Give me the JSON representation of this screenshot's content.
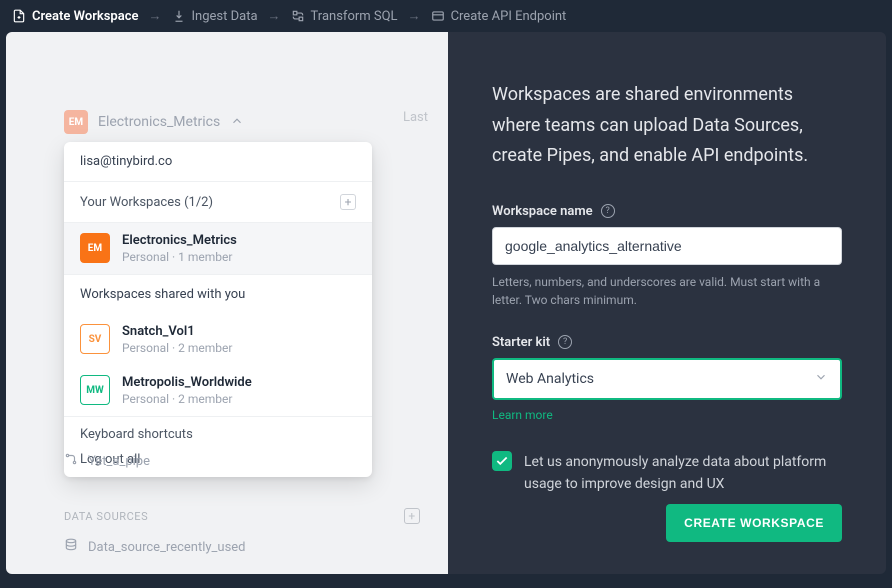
{
  "breadcrumbs": {
    "create_workspace": "Create Workspace",
    "ingest_data": "Ingest Data",
    "transform_sql": "Transform SQL",
    "create_api": "Create API Endpoint"
  },
  "workspace_switcher": {
    "badge": "EM",
    "current_name": "Electronics_Metrics",
    "last_label": "Last"
  },
  "dropdown": {
    "email": "lisa@tinybird.co",
    "your_ws_header": "Your Workspaces (1/2)",
    "own": {
      "badge": "EM",
      "name": "Electronics_Metrics",
      "meta": "Personal · 1 member"
    },
    "shared_header": "Workspaces shared with you",
    "shared": [
      {
        "badge": "SV",
        "name": "Snatch_Vol1",
        "meta": "Personal · 2 member"
      },
      {
        "badge": "MW",
        "name": "Metropolis_Worldwide",
        "meta": "Personal · 2 member"
      }
    ],
    "keyboard_shortcuts": "Keyboard shortcuts",
    "logout": "Log out all"
  },
  "ghost": {
    "pipe": "Yet_a_pipe",
    "ds_header": "DATA SOURCES",
    "ds_item": "Data_source_recently_used"
  },
  "panel": {
    "intro": "Workspaces are shared environments where teams can upload Data Sources, create Pipes, and enable API endpoints.",
    "name_label": "Workspace name",
    "name_value": "google_analytics_alternative",
    "name_hint": "Letters, numbers, and underscores are valid. Must start with a letter. Two chars minimum.",
    "kit_label": "Starter kit",
    "kit_value": "Web Analytics",
    "learn_more": "Learn more",
    "consent": "Let us anonymously analyze data about platform usage to improve design and UX",
    "create_btn": "CREATE WORKSPACE"
  }
}
